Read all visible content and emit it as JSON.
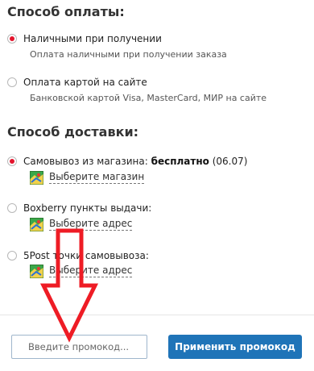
{
  "payment": {
    "title": "Способ оплаты:",
    "options": [
      {
        "label": "Наличными при получении",
        "description": "Оплата наличными при получении заказа",
        "selected": true
      },
      {
        "label": "Оплата картой на сайте",
        "description": "Банковской картой Visa, MasterCard, МИР на сайте",
        "selected": false
      }
    ]
  },
  "delivery": {
    "title": "Способ доставки:",
    "options": [
      {
        "label": "Самовывоз из магазина:",
        "price": "бесплатно",
        "date": "(06.07)",
        "link": "Выберите магазин",
        "selected": true
      },
      {
        "label": "Boxberry пункты выдачи:",
        "link": "Выберите адрес",
        "selected": false
      },
      {
        "label": "5Post точки самовывоза:",
        "link": "Выберите адрес",
        "selected": false
      }
    ]
  },
  "promo": {
    "placeholder": "Введите промокод...",
    "apply_label": "Применить промокод"
  },
  "colors": {
    "radio_selected": "#e3142d",
    "apply_button": "#1f74b8",
    "annotation_arrow": "#ee1c25"
  }
}
